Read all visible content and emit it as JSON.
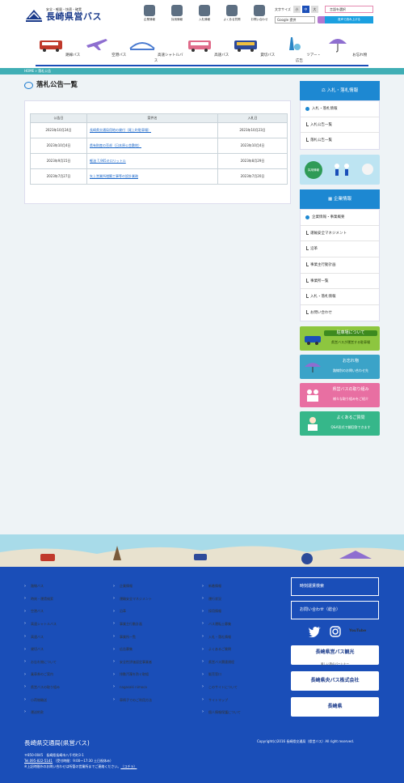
{
  "header": {
    "logo_sub": "安全・軽量・快適・確実",
    "logo_main": "長崎県営バス",
    "util": [
      {
        "label": "企業情報",
        "icon": "building-icon"
      },
      {
        "label": "採用情報",
        "icon": "people-icon"
      },
      {
        "label": "入札情報",
        "icon": "pen-icon"
      },
      {
        "label": "よくある質問",
        "icon": "qa-icon"
      },
      {
        "label": "お問い合わせ",
        "icon": "phone-icon"
      }
    ],
    "fontsize_label": "文字サイズ",
    "fontsize_options": [
      "小",
      "中",
      "大"
    ],
    "language": "言語を選択",
    "search_placeholder": "Google 提供",
    "voice": "音声で読み上げる"
  },
  "nav": [
    "路線バス",
    "空港バス",
    "高速シャトルバス",
    "高速バス",
    "貸切バス",
    "ツアー・広告",
    "お忘れ物"
  ],
  "breadcrumb": {
    "home": "HOME",
    "current": "落札公告"
  },
  "page_title": "落札公告一覧",
  "table": {
    "headers": [
      "公告日",
      "案件名",
      "入札日"
    ],
    "rows": [
      {
        "date": "2023年10月24日",
        "name": "長崎県交通局用地の貸付（尾上町駐車場）",
        "bid": "2023年10月23日"
      },
      {
        "date": "2023年10月4日",
        "name": "県有財産の売却（日本原公舎敷地）",
        "bid": "2023年10月4日"
      },
      {
        "date": "2023年9月15日",
        "name": "軽油 7,965キロリットル",
        "bid": "2023年8月29日"
      },
      {
        "date": "2023年7月27日",
        "name": "矢上営業所増築工事等の設計業務",
        "bid": "2023年7月20日"
      }
    ]
  },
  "side": {
    "bid_title": "入札・落札情報",
    "bid_items": [
      "入札・落札情報",
      "入札公告一覧",
      "落札公告一覧"
    ],
    "recruit_banner": "採用情報",
    "company_title": "企業情報",
    "company_items": [
      "企業情報・事業概要",
      "運輸安全マネジメント",
      "沿革",
      "事業主行動計画",
      "事業所一覧",
      "入札・落札情報",
      "お問い合わせ"
    ],
    "banners": [
      {
        "title": "駐車場について",
        "sub": "県営バスが運営する駐車場"
      },
      {
        "title": "お忘れ物",
        "sub": "路線別のお問い合わせ先"
      },
      {
        "title": "県営バスの取り組み",
        "sub": "様々な取り組みをご紹介"
      },
      {
        "title": "よくあるご質問",
        "sub": "Q&A形式で御回答できます"
      }
    ]
  },
  "footer": {
    "col1": [
      "路線バス",
      "時刻・運賃検索",
      "空港バス",
      "高速シャトルバス",
      "高速バス",
      "貸切バス",
      "お忘れ物について",
      "乗車券のご案内",
      "県営バスの取り組み",
      "小荷物輸送",
      "運送約款"
    ],
    "col2": [
      "企業情報",
      "運輸安全マネジメント",
      "沿革",
      "事業主行動計画",
      "事業所一覧",
      "広告募集",
      "安全性評価認定事業者",
      "排動汚濁を防ぐ取組",
      "nagasaki nimoca",
      "車椅子でのご利用方法"
    ],
    "col3": [
      "新着情報",
      "運行状況",
      "採用情報",
      "バス運転士募集",
      "入札・落札情報",
      "よくあるご質問",
      "県営バス関連規程",
      "販売窓口",
      "このサイトについて",
      "サイトマップ",
      "個人情報保護について"
    ],
    "btn_timetable": "時刻運賃検索",
    "btn_contact": "お問い合わせ（総合）",
    "youtube": "YouTube",
    "bnr1": "長崎県営バス観光",
    "bnr1_sub": "楽しい旅のパートナー",
    "bnr2": "長崎県央バス株式会社",
    "bnr3": "長崎県",
    "org_name": "長崎県交通局(県営バス)",
    "addr1": "〒850-0045　長崎県長崎市八千代町3-1",
    "phone": "Tel.095-822-5141",
    "hours": "（受付時間：9:00～17:30 土日祝休み）",
    "note": "※上記時間外のお問い合わせは所管の営業所までご連絡ください。",
    "note_link": "（コチラ）",
    "copyright": "Copyright(c)2016 長崎県交通局（県営バス）All right reserved."
  },
  "colors": {
    "primary": "#1a4eb8",
    "accent": "#1d88d2",
    "teal": "#40aeb5"
  }
}
